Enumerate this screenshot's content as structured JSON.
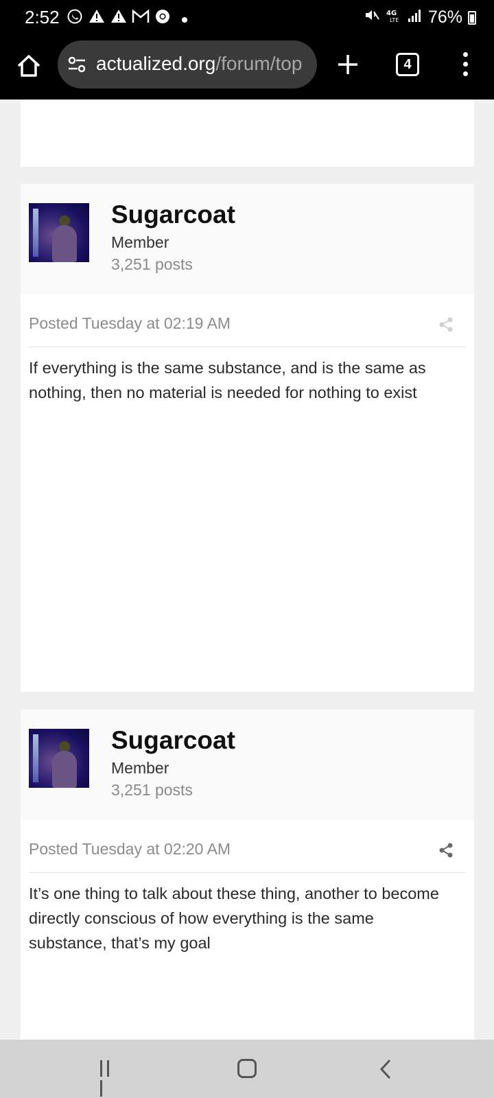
{
  "status_bar": {
    "time": "2:52",
    "battery": "76%"
  },
  "browser": {
    "url_domain": "actualized.org",
    "url_path": "/forum/top",
    "tab_count": "4"
  },
  "posts": [
    {
      "author": "Sugarcoat",
      "rank": "Member",
      "post_count": "3,251 posts",
      "timestamp": "Posted Tuesday at 02:19 AM",
      "body": "If everything is the same substance, and is the same as nothing, then no material is needed for nothing to exist"
    },
    {
      "author": "Sugarcoat",
      "rank": "Member",
      "post_count": "3,251 posts",
      "timestamp": "Posted Tuesday at 02:20 AM",
      "body": "It’s one thing to talk about these thing, another to become directly conscious of how everything is the same substance, that’s my goal"
    }
  ],
  "icons": {
    "status_left": [
      "whatsapp-icon",
      "alert-icon",
      "alert-icon",
      "gmail-icon",
      "chrome-icon",
      "dot-icon"
    ],
    "status_right": [
      "mute-icon",
      "4g-lte-icon",
      "signal-icon",
      "battery-icon"
    ]
  }
}
